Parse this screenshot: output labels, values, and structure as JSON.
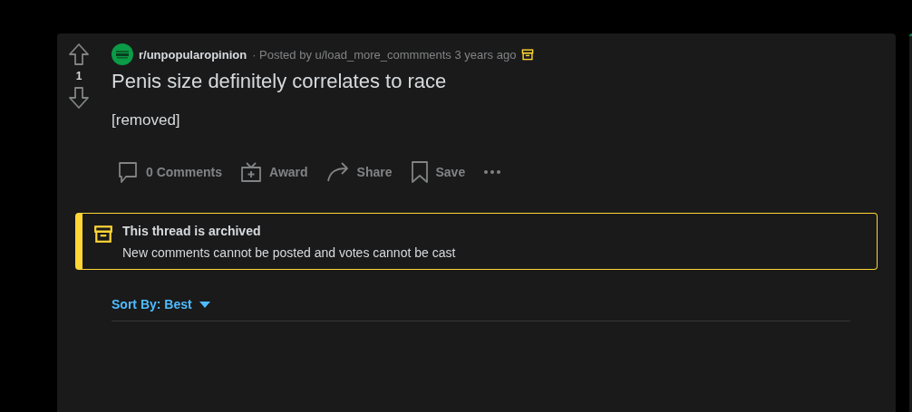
{
  "post": {
    "votes": "1",
    "subreddit": "r/unpopularopinion",
    "meta": "· Posted by u/load_more_commments 3 years ago",
    "archived": true,
    "title": "Penis size definitely correlates to race",
    "body": "[removed]"
  },
  "actions": [
    {
      "kind": "comments",
      "label": "0 Comments"
    },
    {
      "kind": "award",
      "label": "Award"
    },
    {
      "kind": "share",
      "label": "Share"
    },
    {
      "kind": "save",
      "label": "Save"
    },
    {
      "kind": "more"
    }
  ],
  "banner": {
    "title": "This thread is archived",
    "text": "New comments cannot be posted and votes cannot be cast"
  },
  "sort": {
    "label": "Sort By: Best"
  }
}
